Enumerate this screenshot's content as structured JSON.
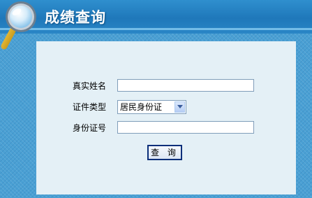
{
  "header": {
    "title": "成绩查询",
    "icon": "magnifier-icon"
  },
  "form": {
    "name_label": "真实姓名",
    "name_value": "",
    "id_type_label": "证件类型",
    "id_type_selected": "居民身份证",
    "id_number_label": "身份证号",
    "id_number_value": "",
    "submit_label": "查 询"
  },
  "colors": {
    "background": "#4aa0d4",
    "header": "#1f78ba",
    "panel": "#e4f0f6",
    "button_border": "#0b2f7a"
  }
}
